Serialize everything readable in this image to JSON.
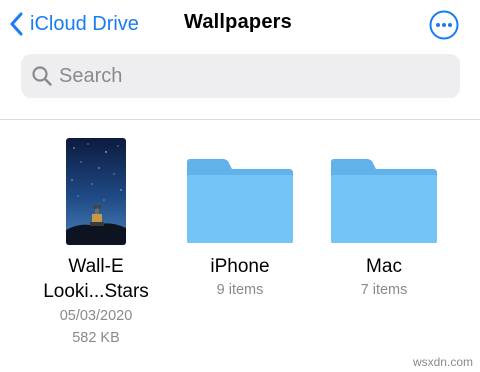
{
  "nav": {
    "back_label": "iCloud Drive",
    "title": "Wallpapers",
    "more_icon": "ellipsis-circle-icon"
  },
  "search": {
    "placeholder": "Search",
    "value": ""
  },
  "items": [
    {
      "kind": "image",
      "name_line1": "Wall-E",
      "name_line2": "Looki...Stars",
      "date": "05/03/2020",
      "size": "582 KB"
    },
    {
      "kind": "folder",
      "name": "iPhone",
      "count": "9 items"
    },
    {
      "kind": "folder",
      "name": "Mac",
      "count": "7 items"
    }
  ],
  "watermark": "wsxdn.com",
  "colors": {
    "accent": "#1a7cf2",
    "folder_front": "#73c4f5",
    "folder_back": "#5fb2ea",
    "search_bg": "#eeeef0",
    "secondary_text": "#8a8a8e"
  }
}
